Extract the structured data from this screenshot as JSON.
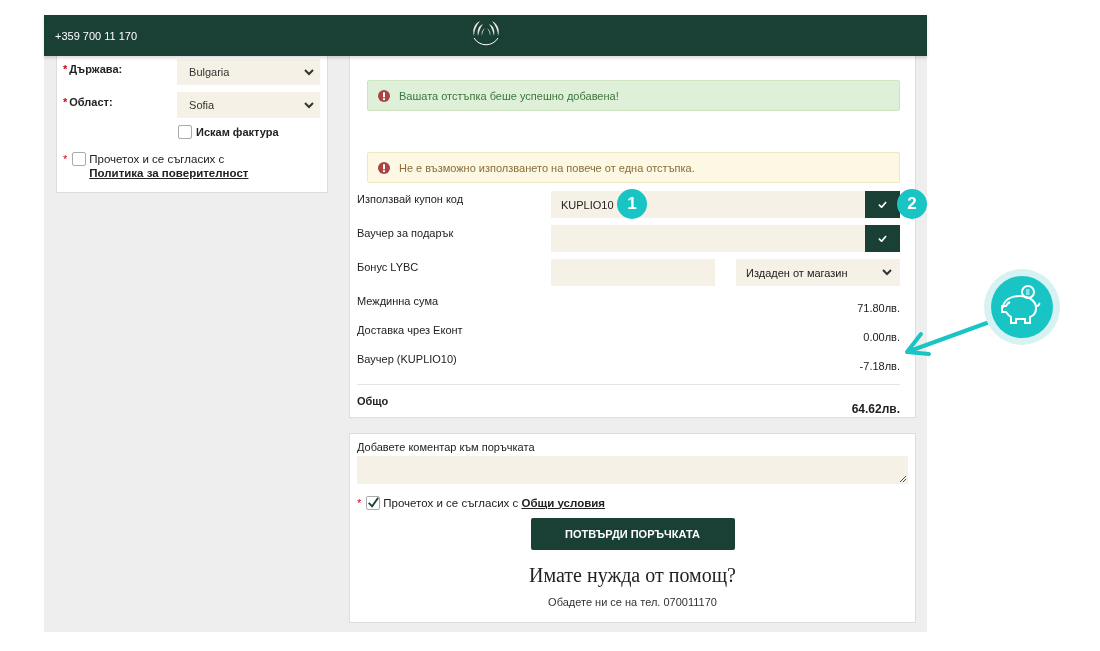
{
  "header": {
    "phone": "+359 700 11 170"
  },
  "address_form": {
    "fields": [
      {
        "required_mark": "*",
        "label": "Държава:",
        "value": "Bulgaria"
      },
      {
        "required_mark": "*",
        "label": "Област:",
        "value": "Sofia"
      }
    ],
    "invoice_checkbox": {
      "label": "Искам фактура",
      "checked": false
    },
    "privacy_consent": {
      "required_mark": "*",
      "checked": false,
      "text": "Прочетох и се съгласих с",
      "link": "Политика за поверителност"
    }
  },
  "alerts": [
    {
      "kind": "success",
      "text": "Вашата отстъпка беше успешно добавена!"
    },
    {
      "kind": "warning",
      "text": "Не е възможно използването на повече от една отстъпка."
    }
  ],
  "discounts": [
    {
      "kind": "code",
      "label": "Използвай купон код",
      "value": "KUPLIO10",
      "badges": [
        "1",
        "2"
      ]
    },
    {
      "kind": "code",
      "label": "Ваучер за подарък"
    },
    {
      "kind": "bonus",
      "label": "Бонус LYBC",
      "select": "Издаден от магазин"
    }
  ],
  "totals": [
    {
      "label": "Междинна сума",
      "amount": "71.80лв."
    },
    {
      "label": "Доставка чрез Еконт",
      "amount": "0.00лв."
    },
    {
      "label": "Ваучер (KUPLIO10)",
      "amount": "-7.18лв."
    }
  ],
  "total": {
    "label": "Общо",
    "amount": "64.62лв."
  },
  "comment": {
    "label": "Добавете коментар към поръчката"
  },
  "terms_consent": {
    "required_mark": "*",
    "checked": true,
    "text": "Прочетох и се съгласих с",
    "link": "Общи условия"
  },
  "confirm_button": "ПОТВЪРДИ ПОРЪЧКАТА",
  "help": {
    "title": "Имате нужда от помощ?",
    "text": "Обадете ни се на тел. 070011170"
  }
}
